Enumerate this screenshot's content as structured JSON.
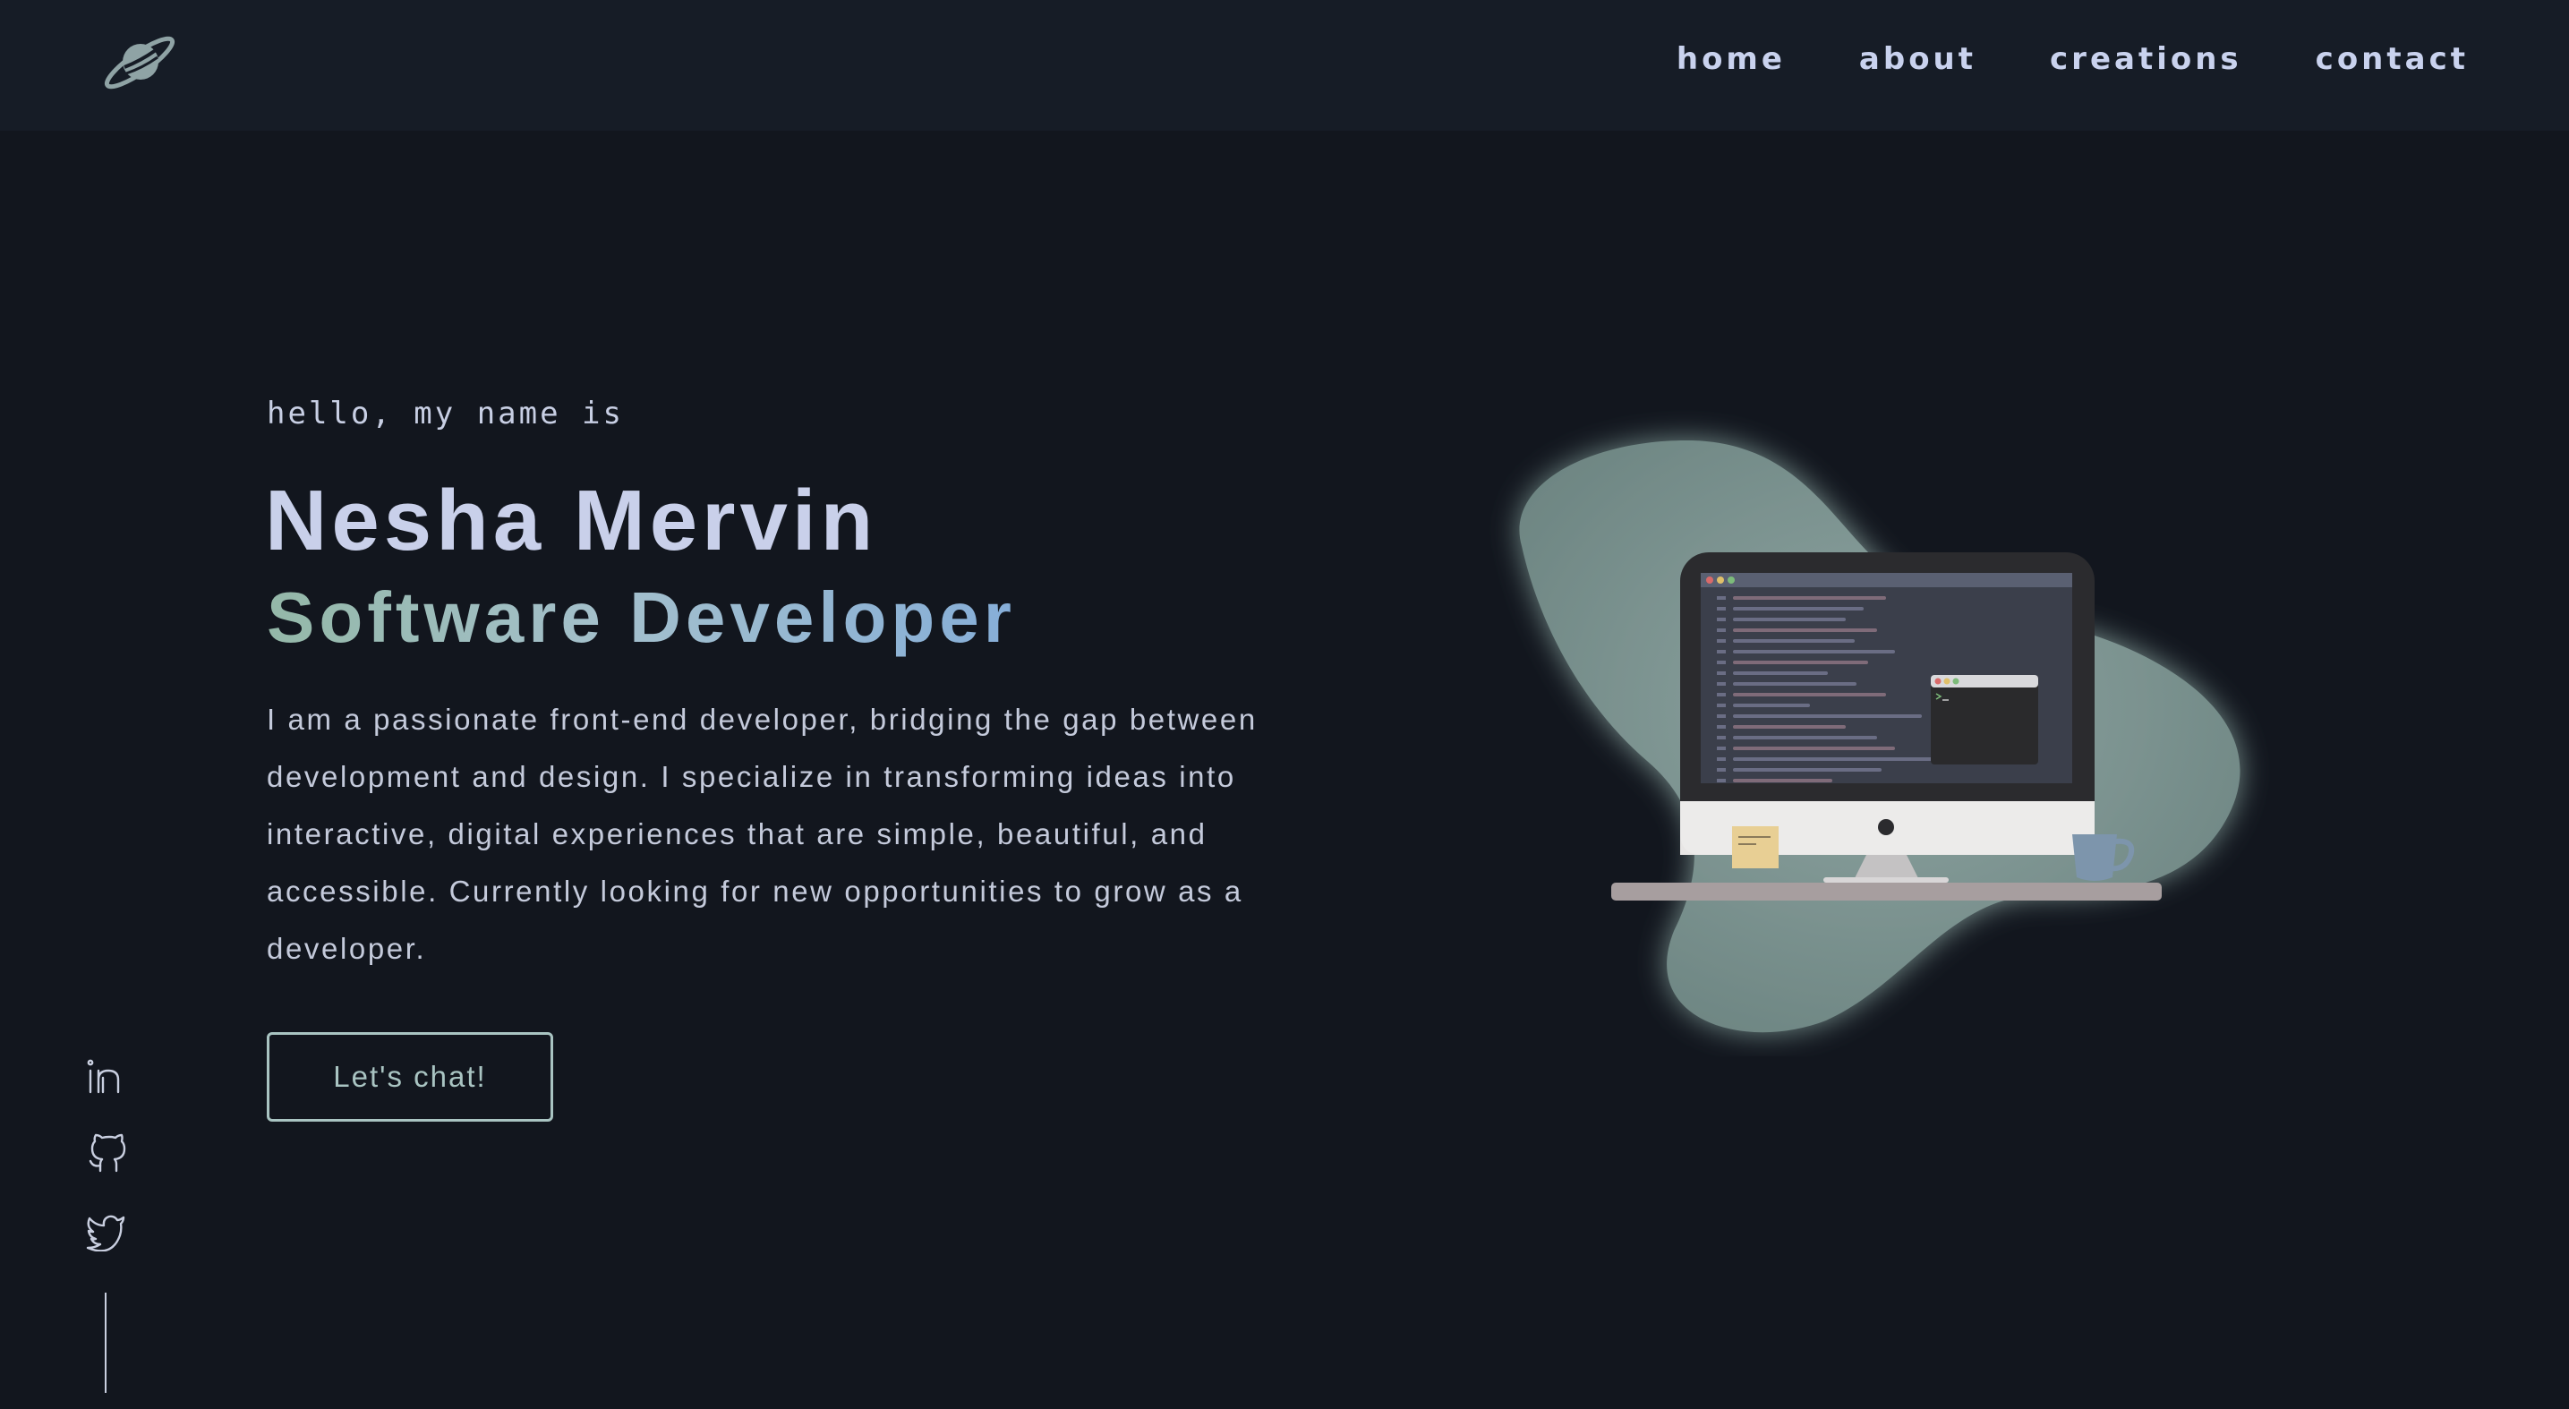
{
  "header": {
    "logo_icon": "planet-icon",
    "nav": [
      {
        "label": "home"
      },
      {
        "label": "about"
      },
      {
        "label": "creations"
      },
      {
        "label": "contact"
      }
    ]
  },
  "hero": {
    "greeting": "hello, my name is",
    "name": "Nesha Mervin",
    "role": "Software Developer",
    "bio": "I am a passionate front-end developer, bridging the gap between development and design. I specialize in transforming ideas into interactive, digital experiences that are simple, beautiful, and accessible. Currently looking for new opportunities to grow as a developer.",
    "cta_label": "Let's chat!",
    "illustration_icon": "desktop-computer-illustration"
  },
  "social": [
    {
      "icon": "linkedin-icon"
    },
    {
      "icon": "github-icon"
    },
    {
      "icon": "twitter-icon"
    }
  ],
  "colors": {
    "background": "#12161e",
    "header": "#161c26",
    "text": "#c9d0ea",
    "accent": "#a9c4c2",
    "gradient_start": "#94b8a8",
    "gradient_end": "#86aed8"
  }
}
